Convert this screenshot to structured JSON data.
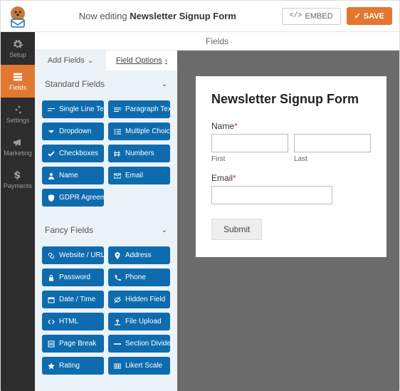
{
  "header": {
    "now_editing": "Now editing",
    "form_name": "Newsletter Signup Form",
    "embed_label": "EMBED",
    "save_label": "SAVE"
  },
  "sidenav": {
    "setup": "Setup",
    "fields": "Fields",
    "settings": "Settings",
    "marketing": "Marketing",
    "payments": "Payments"
  },
  "panel": {
    "fields_bar": "Fields",
    "tab_add": "Add Fields",
    "tab_options": "Field Options",
    "standard_header": "Standard Fields",
    "standard": {
      "single_line": "Single Line Text",
      "paragraph": "Paragraph Text",
      "dropdown": "Dropdown",
      "multiple_choice": "Multiple Choice",
      "checkboxes": "Checkboxes",
      "numbers": "Numbers",
      "name": "Name",
      "email": "Email",
      "gdpr": "GDPR Agreement"
    },
    "fancy_header": "Fancy Fields",
    "fancy": {
      "website": "Website / URL",
      "address": "Address",
      "password": "Password",
      "phone": "Phone",
      "datetime": "Date / Time",
      "hidden": "Hidden Field",
      "html": "HTML",
      "fileupload": "File Upload",
      "pagebreak": "Page Break",
      "section": "Section Divider",
      "rating": "Rating",
      "likert": "Likert Scale"
    }
  },
  "form": {
    "title": "Newsletter Signup Form",
    "name_label": "Name",
    "first_label": "First",
    "last_label": "Last",
    "email_label": "Email",
    "submit_label": "Submit"
  }
}
